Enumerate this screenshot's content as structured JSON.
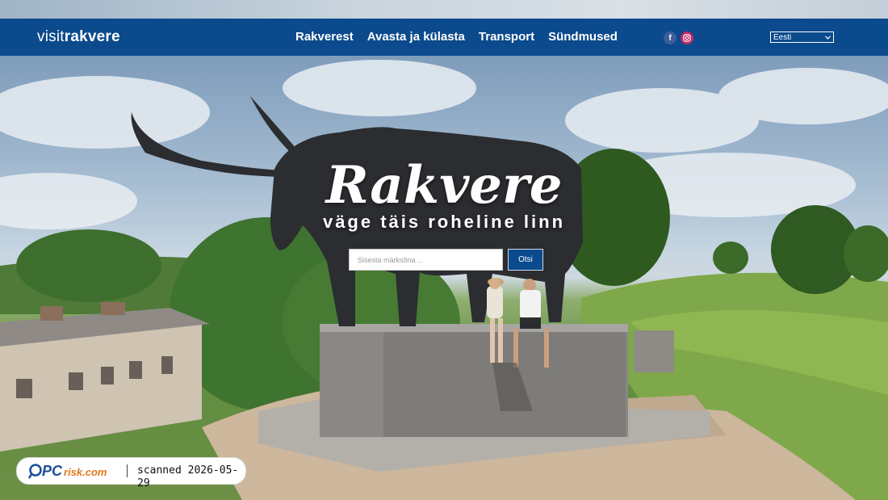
{
  "header": {
    "logo_light": "visit",
    "logo_bold": "rakvere",
    "nav": [
      "Rakverest",
      "Avasta ja külasta",
      "Transport",
      "Sündmused"
    ],
    "social": [
      {
        "name": "facebook-icon",
        "glyph": "f"
      },
      {
        "name": "instagram-icon",
        "glyph": "◎"
      }
    ],
    "language": {
      "selected": "Eesti"
    }
  },
  "hero": {
    "title": "Rakvere",
    "subtitle": "väge täis roheline linn",
    "search": {
      "placeholder": "Sisesta märksõna ...",
      "button": "Otsi"
    }
  },
  "watermark": {
    "brand": "PCrisk.com",
    "text": "scanned 2026-05-29"
  },
  "colors": {
    "header": "#0b4a8c",
    "instagram": "#c22a67",
    "facebook": "#3b5d9a"
  }
}
